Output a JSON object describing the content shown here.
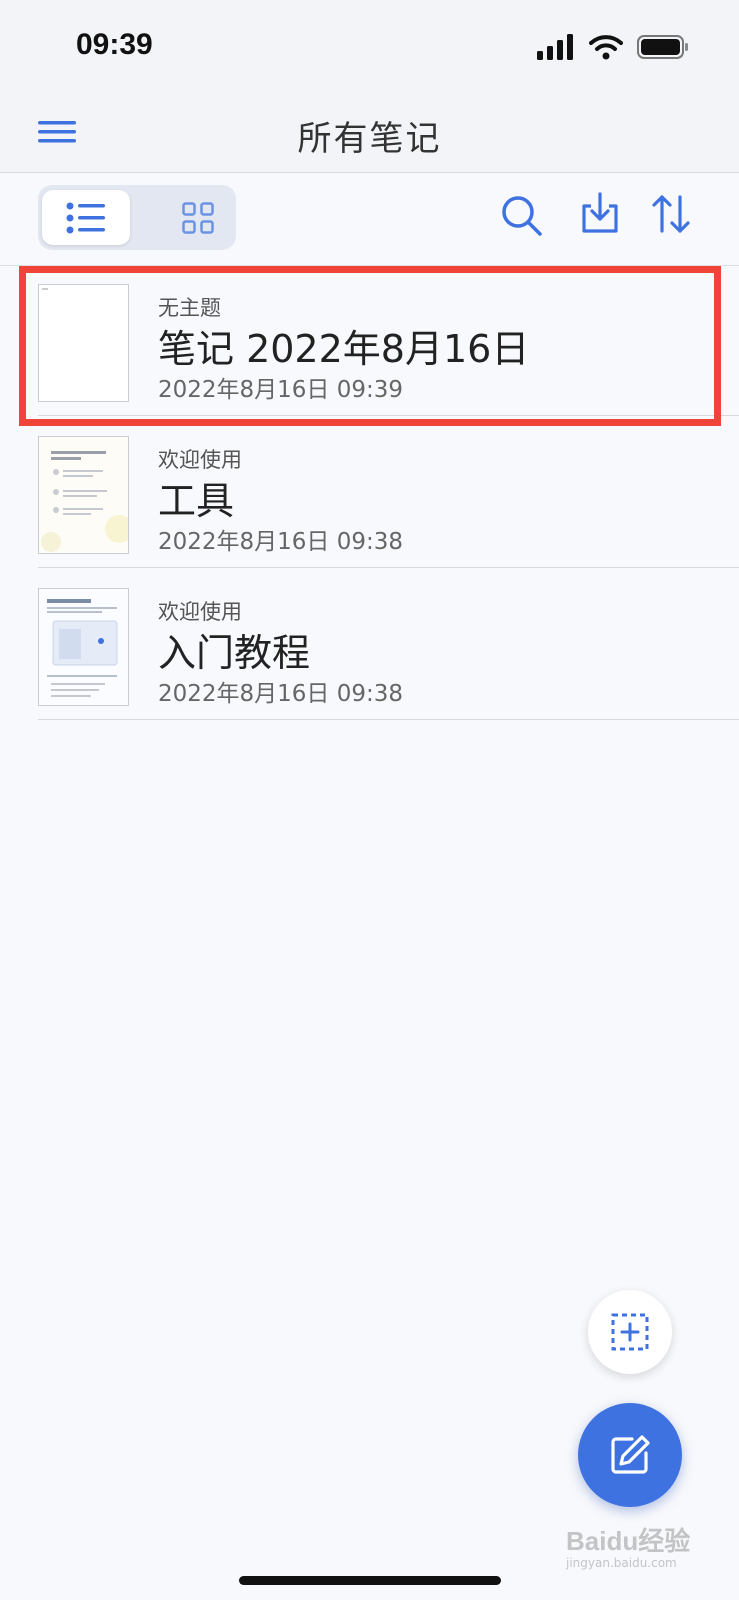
{
  "status_bar": {
    "time": "09:39"
  },
  "nav": {
    "title": "所有笔记"
  },
  "toolbar": {
    "view_modes": [
      "list",
      "grid"
    ],
    "active_view": "list"
  },
  "notes": [
    {
      "subtitle": "无主题",
      "title": "笔记 2022年8月16日",
      "date": "2022年8月16日 09:39",
      "highlighted": true
    },
    {
      "subtitle": "欢迎使用",
      "title": "工具",
      "date": "2022年8月16日 09:38",
      "highlighted": false
    },
    {
      "subtitle": "欢迎使用",
      "title": "入门教程",
      "date": "2022年8月16日 09:38",
      "highlighted": false
    }
  ],
  "watermark": {
    "text": "Baidu经验",
    "sub": "jingyan.baidu.com"
  },
  "colors": {
    "accent": "#3e72e0",
    "highlight": "#ef4437",
    "background": "#f8f9fc"
  }
}
